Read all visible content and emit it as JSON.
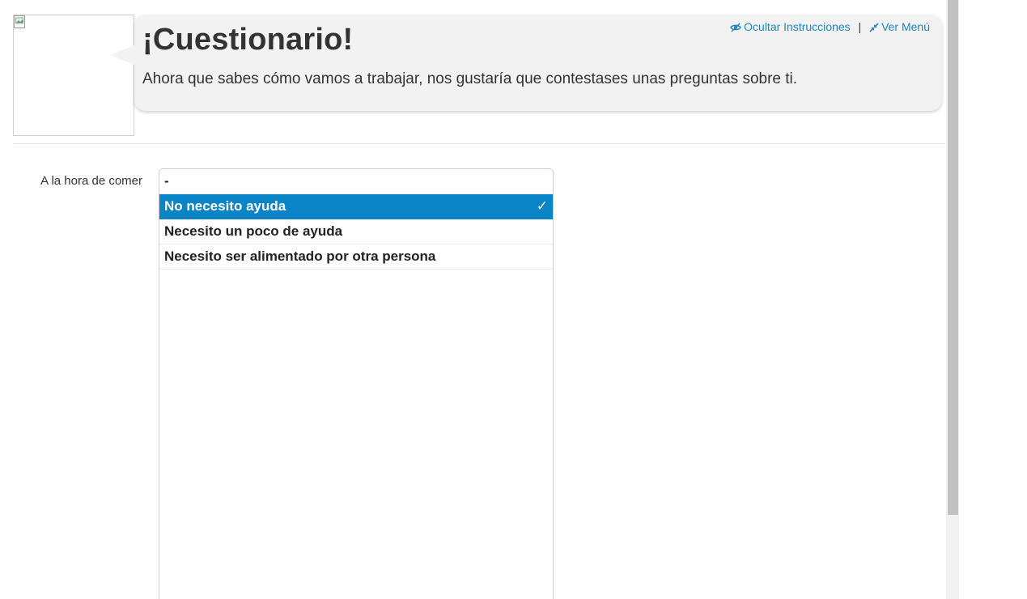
{
  "header": {
    "title": "¡Cuestionario!",
    "text": "Ahora que sabes cómo vamos a trabajar, nos gustaría que contestases unas preguntas sobre ti.",
    "links": {
      "hide_instructions": "Ocultar Instrucciones",
      "separator": "|",
      "view_menu": "Ver Menú"
    },
    "link_color": "#1a87c4"
  },
  "icons": {
    "hide_instructions": "eye-slash-icon",
    "view_menu": "compress-arrows-icon",
    "avatar": "broken-image-icon",
    "selected_check": "check-icon"
  },
  "question": {
    "label": "A la hora de comer",
    "options": [
      {
        "label": "-",
        "selected": false
      },
      {
        "label": "No necesito ayuda",
        "selected": true
      },
      {
        "label": "Necesito un poco de ayuda",
        "selected": false
      },
      {
        "label": "Necesito ser alimentado por otra persona",
        "selected": false
      }
    ],
    "check_glyph": "✓",
    "selected_color": "#0a84c6"
  }
}
